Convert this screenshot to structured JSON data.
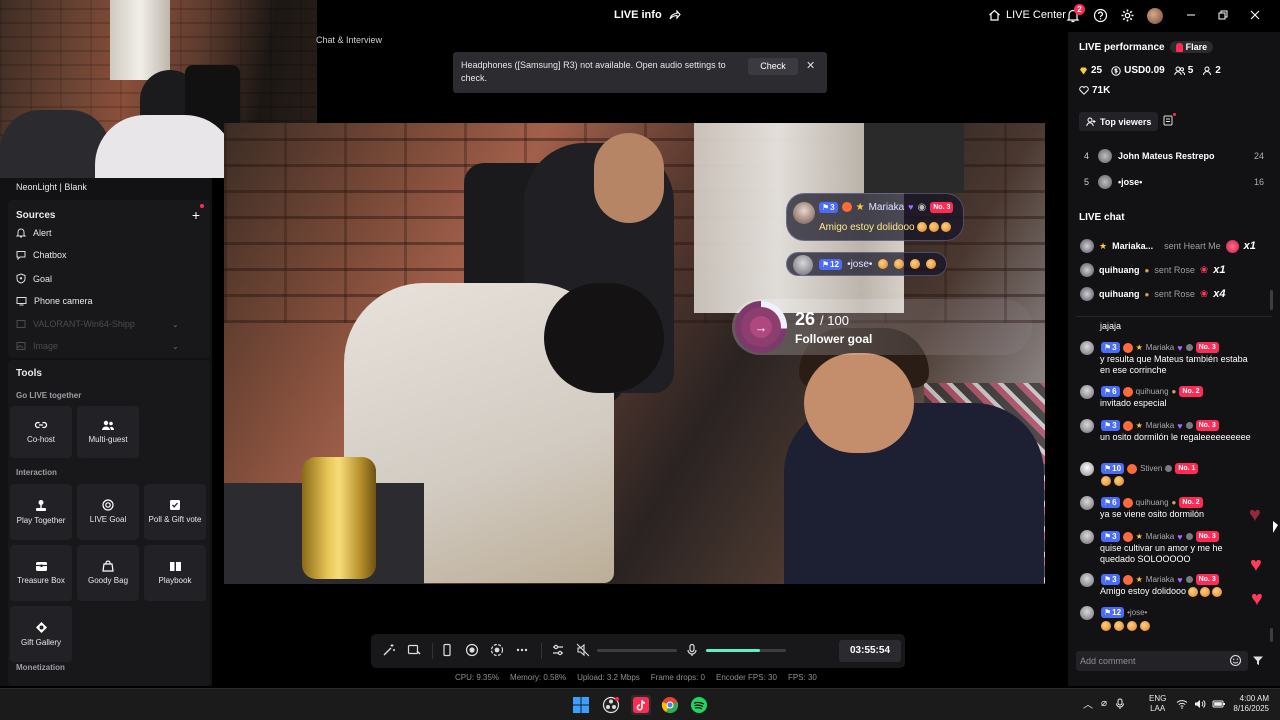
{
  "titlebar": {
    "live_info": "LIVE info",
    "live_center": "LIVE Center",
    "notification_count": "2"
  },
  "webcam": {
    "label": "Chat & Interview"
  },
  "toast": {
    "message": "Headphones ([Samsung] R3) not available. Open audio settings to check.",
    "check_label": "Check",
    "close_label": "✕"
  },
  "left_panel": {
    "scene_name": "NeonLight | Blank",
    "sources": {
      "title": "Sources",
      "add_label": "+",
      "items": [
        {
          "label": "Alert",
          "icon": "bell-icon"
        },
        {
          "label": "Chatbox",
          "icon": "chat-icon"
        },
        {
          "label": "Goal",
          "icon": "shield-icon"
        },
        {
          "label": "Phone camera",
          "icon": "phone-camera-icon"
        },
        {
          "label": "VALORANT-Win64-Shipp",
          "icon": "window-icon"
        },
        {
          "label": "Image",
          "icon": "image-icon"
        }
      ]
    },
    "tools": {
      "title": "Tools",
      "groups": [
        {
          "label": "Go LIVE together",
          "items": [
            "Co-host",
            "Multi-guest"
          ]
        },
        {
          "label": "Interaction",
          "items": [
            "Play Together",
            "LIVE Goal",
            "Poll & Gift vote",
            "Treasure Box",
            "Goody Bag",
            "Playbook",
            "Gift Gallery"
          ]
        },
        {
          "label": "Monetization",
          "items": []
        }
      ]
    }
  },
  "stage": {
    "overlay_chat": [
      {
        "level": "3",
        "username": "Mariaka",
        "rank": "No. 3",
        "message": "Amigo estoy dolidooo"
      },
      {
        "level": "12",
        "username": "•jose•",
        "message": ""
      }
    ],
    "goal": {
      "current": "26",
      "target": "/ 100",
      "label": "Follower goal",
      "progress": 0.26
    }
  },
  "controls": {
    "timer": "03:55:54",
    "mic_level": 0.68,
    "volume_level": 0.0,
    "stats": [
      "CPU: 9.35%",
      "Memory: 0.58%",
      "Upload: 3.2 Mbps",
      "Frame drops: 0",
      "Encoder FPS: 30",
      "FPS: 30"
    ]
  },
  "right_panel": {
    "perf_title": "LIVE performance",
    "flare": "Flare",
    "diamonds": "25",
    "usd": "USD0.09",
    "viewers": "5",
    "new_followers": "2",
    "likes": "71K",
    "top_viewers_label": "Top viewers",
    "top_viewers": [
      {
        "rank": "4",
        "name": "John Mateus Restrepo",
        "score": "24"
      },
      {
        "rank": "5",
        "name": "•jose•",
        "score": "16"
      }
    ],
    "live_chat_title": "LIVE chat",
    "gifts": [
      {
        "name": "Mariaka...",
        "action": "sent Heart Me",
        "mult": "x1"
      },
      {
        "name": "quihuang",
        "action": "sent Rose",
        "mult": "x1"
      },
      {
        "name": "quihuang",
        "action": "sent Rose",
        "mult": "x4"
      }
    ],
    "messages": [
      {
        "level": "",
        "name": "",
        "rank": "",
        "text": "jajaja"
      },
      {
        "level": "3",
        "name": "Mariaka",
        "rank": "No. 3",
        "text": "y resulta que Mateus también estaba en ese corrinche"
      },
      {
        "level": "6",
        "name": "quihuang",
        "rank": "No. 2",
        "text": "invitado especial"
      },
      {
        "level": "3",
        "name": "Mariaka",
        "rank": "No. 3",
        "text": "un osito dormilón le regaleeeeeeeeee"
      },
      {
        "level": "10",
        "name": "Stiven",
        "rank": "No. 1",
        "text": ""
      },
      {
        "level": "6",
        "name": "quihuang",
        "rank": "No. 2",
        "text": "ya se viene osito dormilón"
      },
      {
        "level": "3",
        "name": "Mariaka",
        "rank": "No. 3",
        "text": "quise cultivar un amor y me he quedado SOLOOOOO"
      },
      {
        "level": "3",
        "name": "Mariaka",
        "rank": "No. 3",
        "text": "Amigo estoy dolidooo"
      },
      {
        "level": "12",
        "name": "•jose•",
        "rank": "",
        "text": ""
      }
    ],
    "comment_placeholder": "Add comment"
  },
  "taskbar": {
    "lang_1": "ENG",
    "lang_2": "LAA",
    "time": "4:00 AM",
    "date": "8/16/2025"
  }
}
